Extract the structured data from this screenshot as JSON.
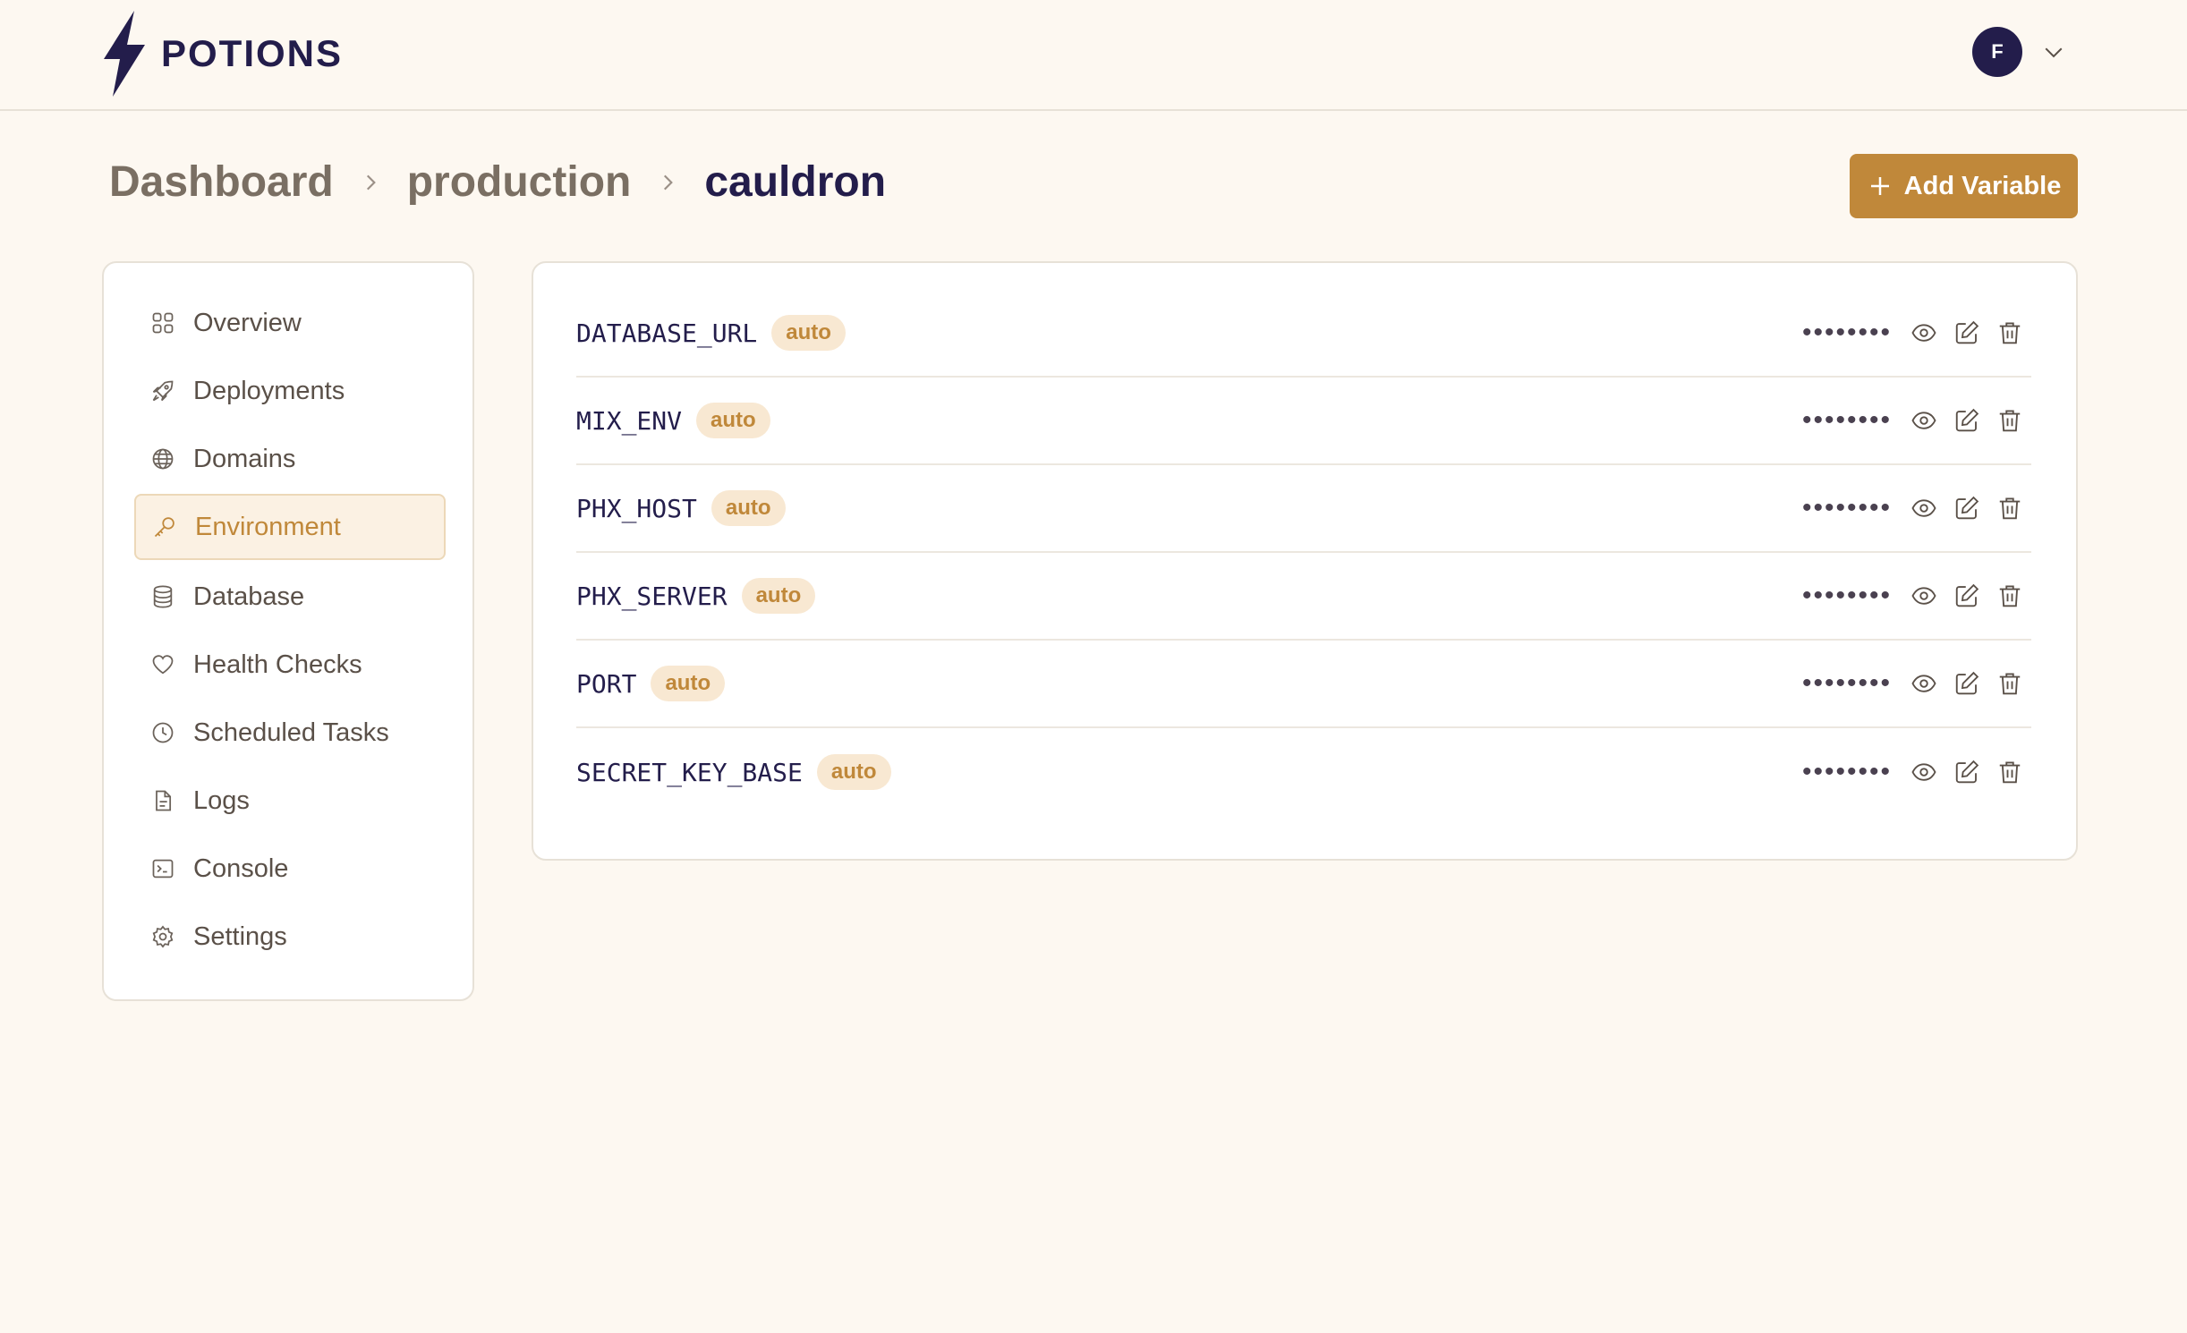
{
  "app": {
    "brand": "POTIONS",
    "user_initial": "F"
  },
  "breadcrumb": {
    "items": [
      "Dashboard",
      "production",
      "cauldron"
    ]
  },
  "actions": {
    "add_variable_label": "Add Variable"
  },
  "sidebar": {
    "items": [
      {
        "label": "Overview",
        "icon": "grid-icon"
      },
      {
        "label": "Deployments",
        "icon": "rocket-icon"
      },
      {
        "label": "Domains",
        "icon": "globe-icon"
      },
      {
        "label": "Environment",
        "icon": "key-icon",
        "active": true
      },
      {
        "label": "Database",
        "icon": "database-icon"
      },
      {
        "label": "Health Checks",
        "icon": "heart-icon"
      },
      {
        "label": "Scheduled Tasks",
        "icon": "clock-icon"
      },
      {
        "label": "Logs",
        "icon": "document-icon"
      },
      {
        "label": "Console",
        "icon": "terminal-icon"
      },
      {
        "label": "Settings",
        "icon": "gear-icon"
      }
    ]
  },
  "variables": [
    {
      "name": "DATABASE_URL",
      "badge": "auto",
      "masked": "••••••••"
    },
    {
      "name": "MIX_ENV",
      "badge": "auto",
      "masked": "••••••••"
    },
    {
      "name": "PHX_HOST",
      "badge": "auto",
      "masked": "••••••••"
    },
    {
      "name": "PHX_SERVER",
      "badge": "auto",
      "masked": "••••••••"
    },
    {
      "name": "PORT",
      "badge": "auto",
      "masked": "••••••••"
    },
    {
      "name": "SECRET_KEY_BASE",
      "badge": "auto",
      "masked": "••••••••"
    }
  ],
  "colors": {
    "accent": "#c0883a",
    "brand": "#231d4b",
    "background": "#fdf8f1"
  }
}
